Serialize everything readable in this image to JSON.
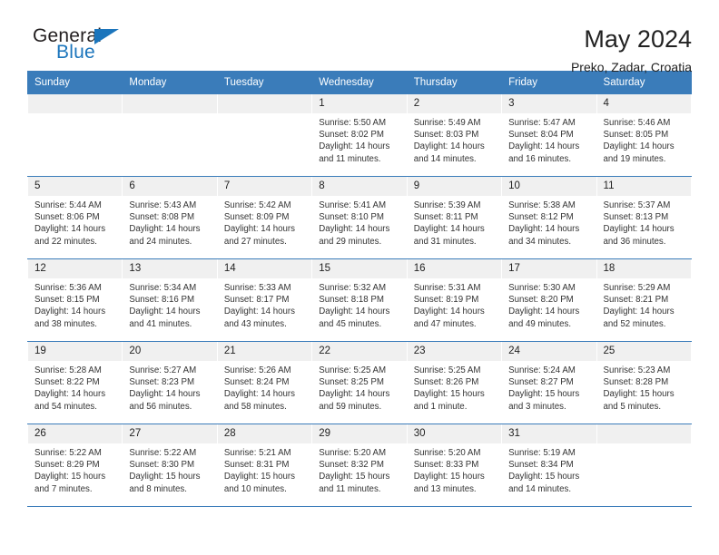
{
  "brand": {
    "name_top": "General",
    "name_bottom": "Blue",
    "accent_color": "#1b75bc"
  },
  "header": {
    "title": "May 2024",
    "subtitle": "Preko, Zadar, Croatia"
  },
  "theme": {
    "header_blue": "#3a7cba",
    "daynum_band": "#f0f0f0"
  },
  "weekday_headers": [
    "Sunday",
    "Monday",
    "Tuesday",
    "Wednesday",
    "Thursday",
    "Friday",
    "Saturday"
  ],
  "weeks": [
    [
      {
        "day": "",
        "lines": []
      },
      {
        "day": "",
        "lines": []
      },
      {
        "day": "",
        "lines": []
      },
      {
        "day": "1",
        "lines": [
          "Sunrise: 5:50 AM",
          "Sunset: 8:02 PM",
          "Daylight: 14 hours",
          "and 11 minutes."
        ]
      },
      {
        "day": "2",
        "lines": [
          "Sunrise: 5:49 AM",
          "Sunset: 8:03 PM",
          "Daylight: 14 hours",
          "and 14 minutes."
        ]
      },
      {
        "day": "3",
        "lines": [
          "Sunrise: 5:47 AM",
          "Sunset: 8:04 PM",
          "Daylight: 14 hours",
          "and 16 minutes."
        ]
      },
      {
        "day": "4",
        "lines": [
          "Sunrise: 5:46 AM",
          "Sunset: 8:05 PM",
          "Daylight: 14 hours",
          "and 19 minutes."
        ]
      }
    ],
    [
      {
        "day": "5",
        "lines": [
          "Sunrise: 5:44 AM",
          "Sunset: 8:06 PM",
          "Daylight: 14 hours",
          "and 22 minutes."
        ]
      },
      {
        "day": "6",
        "lines": [
          "Sunrise: 5:43 AM",
          "Sunset: 8:08 PM",
          "Daylight: 14 hours",
          "and 24 minutes."
        ]
      },
      {
        "day": "7",
        "lines": [
          "Sunrise: 5:42 AM",
          "Sunset: 8:09 PM",
          "Daylight: 14 hours",
          "and 27 minutes."
        ]
      },
      {
        "day": "8",
        "lines": [
          "Sunrise: 5:41 AM",
          "Sunset: 8:10 PM",
          "Daylight: 14 hours",
          "and 29 minutes."
        ]
      },
      {
        "day": "9",
        "lines": [
          "Sunrise: 5:39 AM",
          "Sunset: 8:11 PM",
          "Daylight: 14 hours",
          "and 31 minutes."
        ]
      },
      {
        "day": "10",
        "lines": [
          "Sunrise: 5:38 AM",
          "Sunset: 8:12 PM",
          "Daylight: 14 hours",
          "and 34 minutes."
        ]
      },
      {
        "day": "11",
        "lines": [
          "Sunrise: 5:37 AM",
          "Sunset: 8:13 PM",
          "Daylight: 14 hours",
          "and 36 minutes."
        ]
      }
    ],
    [
      {
        "day": "12",
        "lines": [
          "Sunrise: 5:36 AM",
          "Sunset: 8:15 PM",
          "Daylight: 14 hours",
          "and 38 minutes."
        ]
      },
      {
        "day": "13",
        "lines": [
          "Sunrise: 5:34 AM",
          "Sunset: 8:16 PM",
          "Daylight: 14 hours",
          "and 41 minutes."
        ]
      },
      {
        "day": "14",
        "lines": [
          "Sunrise: 5:33 AM",
          "Sunset: 8:17 PM",
          "Daylight: 14 hours",
          "and 43 minutes."
        ]
      },
      {
        "day": "15",
        "lines": [
          "Sunrise: 5:32 AM",
          "Sunset: 8:18 PM",
          "Daylight: 14 hours",
          "and 45 minutes."
        ]
      },
      {
        "day": "16",
        "lines": [
          "Sunrise: 5:31 AM",
          "Sunset: 8:19 PM",
          "Daylight: 14 hours",
          "and 47 minutes."
        ]
      },
      {
        "day": "17",
        "lines": [
          "Sunrise: 5:30 AM",
          "Sunset: 8:20 PM",
          "Daylight: 14 hours",
          "and 49 minutes."
        ]
      },
      {
        "day": "18",
        "lines": [
          "Sunrise: 5:29 AM",
          "Sunset: 8:21 PM",
          "Daylight: 14 hours",
          "and 52 minutes."
        ]
      }
    ],
    [
      {
        "day": "19",
        "lines": [
          "Sunrise: 5:28 AM",
          "Sunset: 8:22 PM",
          "Daylight: 14 hours",
          "and 54 minutes."
        ]
      },
      {
        "day": "20",
        "lines": [
          "Sunrise: 5:27 AM",
          "Sunset: 8:23 PM",
          "Daylight: 14 hours",
          "and 56 minutes."
        ]
      },
      {
        "day": "21",
        "lines": [
          "Sunrise: 5:26 AM",
          "Sunset: 8:24 PM",
          "Daylight: 14 hours",
          "and 58 minutes."
        ]
      },
      {
        "day": "22",
        "lines": [
          "Sunrise: 5:25 AM",
          "Sunset: 8:25 PM",
          "Daylight: 14 hours",
          "and 59 minutes."
        ]
      },
      {
        "day": "23",
        "lines": [
          "Sunrise: 5:25 AM",
          "Sunset: 8:26 PM",
          "Daylight: 15 hours",
          "and 1 minute."
        ]
      },
      {
        "day": "24",
        "lines": [
          "Sunrise: 5:24 AM",
          "Sunset: 8:27 PM",
          "Daylight: 15 hours",
          "and 3 minutes."
        ]
      },
      {
        "day": "25",
        "lines": [
          "Sunrise: 5:23 AM",
          "Sunset: 8:28 PM",
          "Daylight: 15 hours",
          "and 5 minutes."
        ]
      }
    ],
    [
      {
        "day": "26",
        "lines": [
          "Sunrise: 5:22 AM",
          "Sunset: 8:29 PM",
          "Daylight: 15 hours",
          "and 7 minutes."
        ]
      },
      {
        "day": "27",
        "lines": [
          "Sunrise: 5:22 AM",
          "Sunset: 8:30 PM",
          "Daylight: 15 hours",
          "and 8 minutes."
        ]
      },
      {
        "day": "28",
        "lines": [
          "Sunrise: 5:21 AM",
          "Sunset: 8:31 PM",
          "Daylight: 15 hours",
          "and 10 minutes."
        ]
      },
      {
        "day": "29",
        "lines": [
          "Sunrise: 5:20 AM",
          "Sunset: 8:32 PM",
          "Daylight: 15 hours",
          "and 11 minutes."
        ]
      },
      {
        "day": "30",
        "lines": [
          "Sunrise: 5:20 AM",
          "Sunset: 8:33 PM",
          "Daylight: 15 hours",
          "and 13 minutes."
        ]
      },
      {
        "day": "31",
        "lines": [
          "Sunrise: 5:19 AM",
          "Sunset: 8:34 PM",
          "Daylight: 15 hours",
          "and 14 minutes."
        ]
      },
      {
        "day": "",
        "lines": []
      }
    ]
  ]
}
